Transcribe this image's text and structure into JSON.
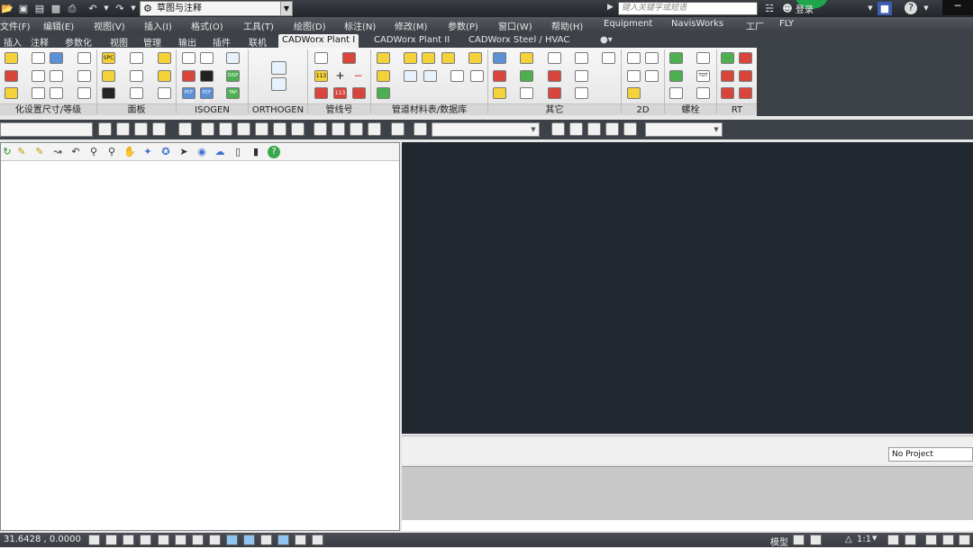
{
  "title_bar": {
    "workspace": "草图与注释",
    "search_placeholder": "键入关键字或短语",
    "login": "登录"
  },
  "menus": [
    "文件(F)",
    "编辑(E)",
    "视图(V)",
    "插入(I)",
    "格式(O)",
    "工具(T)",
    "绘图(D)",
    "标注(N)",
    "修改(M)",
    "参数(P)",
    "窗口(W)",
    "帮助(H)",
    "Equipment",
    "NavisWorks",
    "工厂",
    "FLY"
  ],
  "ribbon_tabs": [
    "插入",
    "注释",
    "参数化",
    "视图",
    "管理",
    "输出",
    "插件",
    "联机",
    "CADWorx Plant I",
    "CADWorx Plant II",
    "CADWorx Steel / HVAC"
  ],
  "active_tab": "CADWorx Plant I",
  "panels": [
    "化设置尺寸/等级",
    "面板",
    "ISOGEN",
    "ORTHOGEN",
    "管线号",
    "管道材料表/数据库",
    "其它",
    "2D",
    "螺栓",
    "RT"
  ],
  "icon_labels": {
    "spc": "SPC",
    "pcf_out": "PCF OUT",
    "pcf_in": "PCF IN",
    "disp": "DISP",
    "tap": "TAP",
    "num1": "113",
    "num2": "113",
    "tot": "TOT",
    "plus": "+",
    "minus": "−"
  },
  "project": "No Project",
  "status": {
    "coords": "31.6428 , 0.0000",
    "model": "模型",
    "scale": "1:1"
  }
}
